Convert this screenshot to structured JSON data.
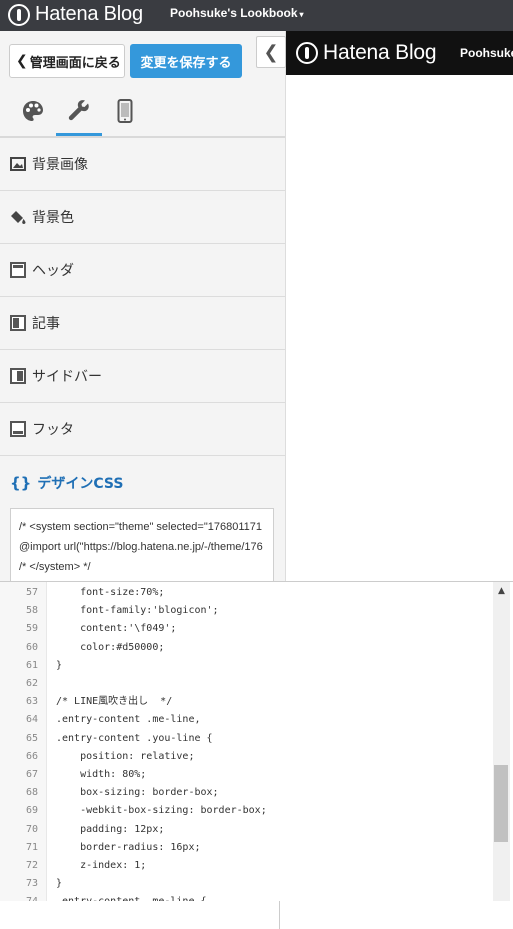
{
  "topbar": {
    "logo_text": "Hatena Blog",
    "blog_title": "Poohsuke's Lookbook",
    "caret": "▾"
  },
  "panel": {
    "back_label": "管理画面に戻る",
    "save_label": "変更を保存する",
    "collapse_glyph": "❮",
    "tabs": [
      {
        "name": "theme",
        "icon": "palette-icon"
      },
      {
        "name": "customize",
        "icon": "wrench-icon",
        "active": true
      },
      {
        "name": "smartphone",
        "icon": "smartphone-icon"
      }
    ],
    "menu": [
      {
        "label": "背景画像",
        "icon": "image-icon"
      },
      {
        "label": "背景色",
        "icon": "paint-bucket-icon"
      },
      {
        "label": "ヘッダ",
        "icon": "header-layout-icon"
      },
      {
        "label": "記事",
        "icon": "article-layout-icon"
      },
      {
        "label": "サイドバー",
        "icon": "sidebar-layout-icon"
      },
      {
        "label": "フッタ",
        "icon": "footer-layout-icon"
      }
    ],
    "css_section": {
      "braces": "{}",
      "label": "デザインCSS"
    },
    "css_preview": "/* <system section=\"theme\" selected=\"176801171\n@import url(\"https://blog.hatena.ne.jp/-/theme/176\n/* </system> */"
  },
  "preview": {
    "logo_text": "Hatena Blog",
    "title": "Poohsuke's"
  },
  "editor": {
    "lines": [
      {
        "n": "57",
        "t": "    font-size:70%;"
      },
      {
        "n": "58",
        "t": "    font-family:'blogicon';"
      },
      {
        "n": "59",
        "t": "    content:'\\f049';"
      },
      {
        "n": "60",
        "t": "    color:#d50000;"
      },
      {
        "n": "61",
        "t": "}"
      },
      {
        "n": "62",
        "t": ""
      },
      {
        "n": "63",
        "t": "/* LINE風吹き出し  */"
      },
      {
        "n": "64",
        "t": ".entry-content .me-line,"
      },
      {
        "n": "65",
        "t": ".entry-content .you-line {"
      },
      {
        "n": "66",
        "t": "    position: relative;"
      },
      {
        "n": "67",
        "t": "    width: 80%;"
      },
      {
        "n": "68",
        "t": "    box-sizing: border-box;"
      },
      {
        "n": "69",
        "t": "    -webkit-box-sizing: border-box;"
      },
      {
        "n": "70",
        "t": "    padding: 12px;"
      },
      {
        "n": "71",
        "t": "    border-radius: 16px;"
      },
      {
        "n": "72",
        "t": "    z-index: 1;"
      },
      {
        "n": "73",
        "t": "}"
      },
      {
        "n": "74",
        "t": ".entry-content .me-line {"
      }
    ],
    "scroll_up": "▲"
  }
}
